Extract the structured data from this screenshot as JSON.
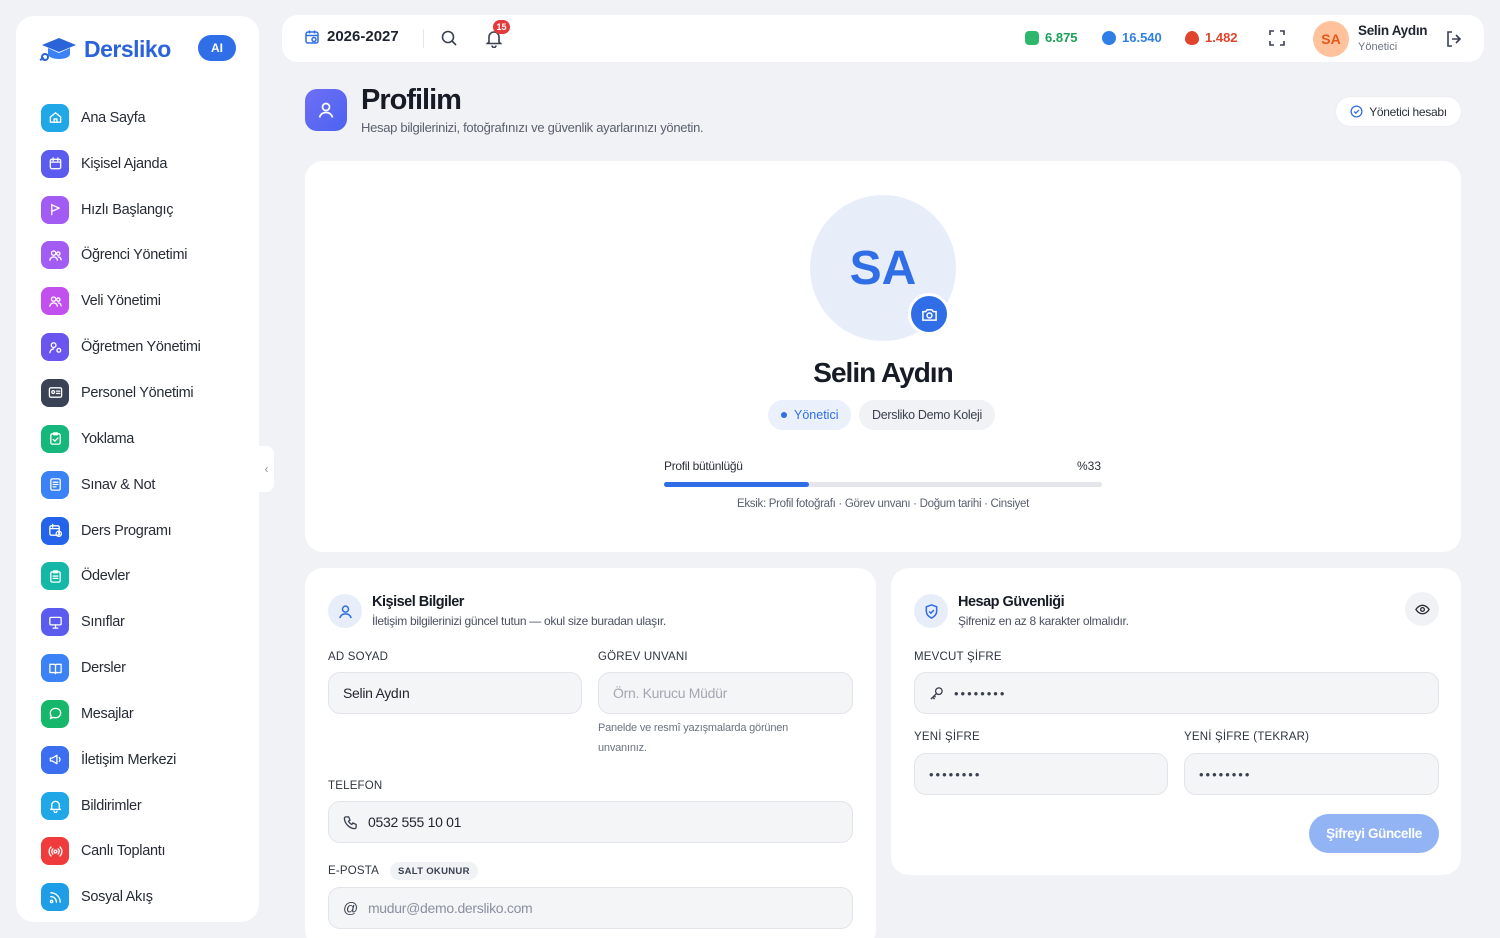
{
  "brand": {
    "name": "Dersliko",
    "ai_badge": "AI"
  },
  "sidebar": {
    "items": [
      {
        "label": "Ana Sayfa",
        "icon": "home-icon",
        "color": "#1fa7e8"
      },
      {
        "label": "Kişisel Ajanda",
        "icon": "calendar-icon",
        "color": "#5b5bf0"
      },
      {
        "label": "Hızlı Başlangıç",
        "icon": "play-flag-icon",
        "color": "#a35cf3"
      },
      {
        "label": "Öğrenci Yönetimi",
        "icon": "users-icon",
        "color": "#a35cf3"
      },
      {
        "label": "Veli Yönetimi",
        "icon": "users-icon",
        "color": "#c250ef"
      },
      {
        "label": "Öğretmen Yönetimi",
        "icon": "user-gear-icon",
        "color": "#6a55ef"
      },
      {
        "label": "Personel Yönetimi",
        "icon": "id-card-icon",
        "color": "#3a4255"
      },
      {
        "label": "Yoklama",
        "icon": "clipboard-check-icon",
        "color": "#16b77a"
      },
      {
        "label": "Sınav & Not",
        "icon": "document-icon",
        "color": "#3b82f6"
      },
      {
        "label": "Ders Programı",
        "icon": "calendar-clock-icon",
        "color": "#2563eb"
      },
      {
        "label": "Ödevler",
        "icon": "clipboard-list-icon",
        "color": "#15b8a6"
      },
      {
        "label": "Sınıflar",
        "icon": "presentation-icon",
        "color": "#5b5bf0"
      },
      {
        "label": "Dersler",
        "icon": "book-icon",
        "color": "#3b82f6"
      },
      {
        "label": "Mesajlar",
        "icon": "chat-icon",
        "color": "#16b76a"
      },
      {
        "label": "İletişim Merkezi",
        "icon": "megaphone-icon",
        "color": "#3b6ef0"
      },
      {
        "label": "Bildirimler",
        "icon": "bell-icon",
        "color": "#1fa7e8"
      },
      {
        "label": "Canlı Toplantı",
        "icon": "broadcast-icon",
        "color": "#ef3b3b"
      },
      {
        "label": "Sosyal Akış",
        "icon": "rss-icon",
        "color": "#1f9ee8"
      }
    ]
  },
  "topbar": {
    "year": "2026-2027",
    "notification_count": "15",
    "stats": [
      {
        "value": "6.875",
        "icon": "coin-green-icon",
        "color": "#18a058"
      },
      {
        "value": "16.540",
        "icon": "gem-blue-icon",
        "color": "#2f7fe6"
      },
      {
        "value": "1.482",
        "icon": "flame-icon",
        "color": "#e0442c"
      }
    ],
    "user": {
      "initials": "SA",
      "name": "Selin Aydın",
      "role": "Yönetici"
    }
  },
  "page": {
    "title": "Profilim",
    "subtitle": "Hesap bilgilerinizi, fotoğrafınızı ve güvenlik ayarlarınızı yönetin.",
    "admin_pill": "Yönetici hesabı"
  },
  "profile": {
    "initials": "SA",
    "name": "Selin Aydın",
    "role": "Yönetici",
    "school": "Dersliko Demo Koleji",
    "completeness_label": "Profil bütünlüğü",
    "completeness_value": "%33",
    "completeness_fraction": 0.33,
    "missing": "Eksik: Profil fotoğrafı · Görev unvanı · Doğum tarihi · Cinsiyet"
  },
  "personal": {
    "title": "Kişisel Bilgiler",
    "subtitle": "İletişim bilgilerinizi güncel tutun — okul size buradan ulaşır.",
    "name_label": "AD SOYAD",
    "name_value": "Selin Aydın",
    "title_label": "GÖREV UNVANI",
    "title_placeholder": "Örn. Kurucu Müdür",
    "title_hint": "Panelde ve resmî yazışmalarda görünen unvanınız.",
    "phone_label": "TELEFON",
    "phone_value": "0532 555 10 01",
    "email_label": "E-POSTA",
    "readonly_tag": "SALT OKUNUR",
    "email_value": "mudur@demo.dersliko.com"
  },
  "security": {
    "title": "Hesap Güvenliği",
    "subtitle": "Şifreniz en az 8 karakter olmalıdır.",
    "current_label": "MEVCUT ŞİFRE",
    "current_value": "••••••••",
    "new_label": "YENİ ŞİFRE",
    "new_value": "••••••••",
    "repeat_label": "YENİ ŞİFRE (TEKRAR)",
    "repeat_value": "••••••••",
    "update_button": "Şifreyi Güncelle"
  }
}
